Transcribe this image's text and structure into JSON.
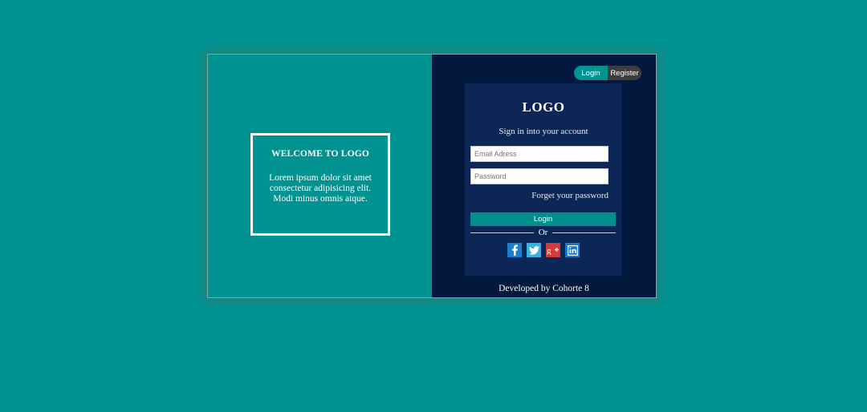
{
  "welcome": {
    "title": "WELCOME TO LOGO",
    "text": "Lorem ipsum dolor sit amet consectetur adipisicing elit. Modi minus omnis atque."
  },
  "tabs": {
    "login_label": "Login",
    "register_label": "Register"
  },
  "form": {
    "logo": "LOGO",
    "subtitle": "Sign in into your account",
    "email_placeholder": "Email Adress",
    "password_placeholder": "Password",
    "forgot_label": "Forget your password",
    "login_button": "Login",
    "divider_text": "Or"
  },
  "social": [
    {
      "icon": "facebook-icon",
      "color": "#1b7fcf"
    },
    {
      "icon": "twitter-icon",
      "color": "#33b3e0"
    },
    {
      "icon": "google-plus-icon",
      "color": "#d13b3b"
    },
    {
      "icon": "linkedin-icon",
      "color": "#1c78c4"
    }
  ],
  "footer": "Developed by Cohorte 8",
  "colors": {
    "background": "#009391",
    "panel_dark": "#02193d",
    "form_bg": "#0b2657",
    "accent": "#008f8d",
    "register_tab": "#3d3d3d"
  }
}
